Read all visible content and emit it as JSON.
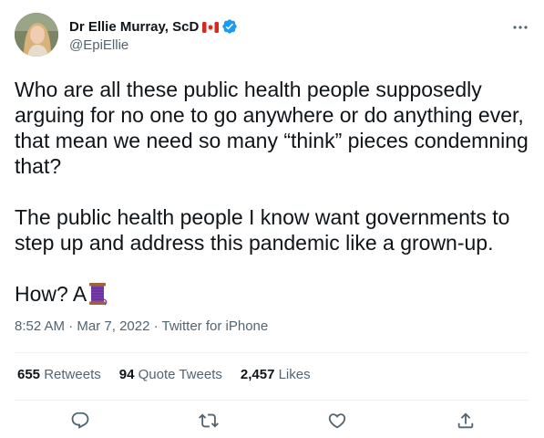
{
  "author": {
    "display_name": "Dr Ellie Murray, ScD",
    "handle": "@EpiEllie",
    "flag_icon": "canada-flag-icon",
    "verified_icon": "verified-badge-icon"
  },
  "tweet": {
    "paragraphs": [
      "Who are all these public health people supposedly arguing for no one to go anywhere or do anything ever, that mean we need so many “think” pieces condemning that?",
      "The public health people I know want governments to step up and address this pandemic like a grown-up.",
      "How? A"
    ],
    "trailing_emoji": "thread-spool-emoji"
  },
  "meta": {
    "time": "8:52 AM",
    "separator1": " · ",
    "date": "Mar 7, 2022",
    "separator2": " · ",
    "source": "Twitter for iPhone"
  },
  "stats": {
    "retweets_count": "655",
    "retweets_label": "Retweets",
    "quotes_count": "94",
    "quotes_label": "Quote Tweets",
    "likes_count": "2,457",
    "likes_label": "Likes"
  },
  "actions": [
    "reply-icon",
    "retweet-icon",
    "like-icon",
    "share-icon"
  ],
  "colors": {
    "text": "#0f1419",
    "secondary": "#536471",
    "divider": "#eff3f4",
    "verified": "#1d9bf0"
  }
}
